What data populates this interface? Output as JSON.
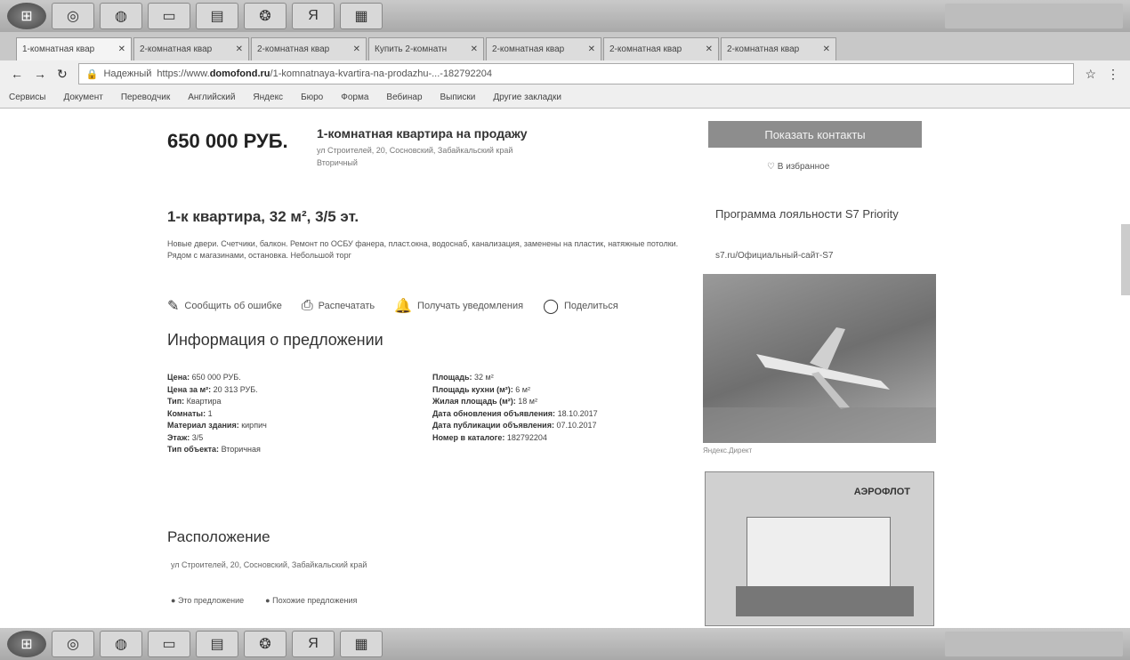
{
  "taskbar": {
    "items": [
      "⊞",
      "◎",
      "◍",
      "▭",
      "▤",
      "❂",
      "Я",
      "▦"
    ]
  },
  "tabs": [
    {
      "label": "1-комнатная квар",
      "active": true
    },
    {
      "label": "2-комнатная квар",
      "active": false
    },
    {
      "label": "2-комнатная квар",
      "active": false
    },
    {
      "label": "Купить 2-комнатн",
      "active": false
    },
    {
      "label": "2-комнатная квар",
      "active": false
    },
    {
      "label": "2-комнатная квар",
      "active": false
    },
    {
      "label": "2-комнатная квар",
      "active": false
    }
  ],
  "browser": {
    "profile": "",
    "secure_label": "Надежный",
    "url_prefix": "https://www.",
    "url_domain": "domofond.ru",
    "url_rest": "/1-komnatnaya-kvartira-na-prodazhu-...-182792204"
  },
  "bookmarks": [
    "Сервисы",
    "Документ",
    "Переводчик",
    "Английский",
    "Яндекс",
    "Бюро",
    "Форма",
    "Вебинар",
    "Выписки",
    "Другие закладки"
  ],
  "listing": {
    "price": "650 000 РУБ.",
    "title": "1-комнатная квартира на продажу",
    "address": "ул Строителей, 20, Сосновский, Забайкальский край",
    "type_label": "Вторичный",
    "heading": "1-к квартира, 32 м², 3/5 эт.",
    "description": "Новые двери. Счетчики, балкон. Ремонт по ОСБУ фанера, пласт.окна, водоснаб, канализация, заменены на пластик, натяжные потолки. Рядом с магазинами, остановка. Небольшой торг",
    "actions": {
      "report": "Сообщить об ошибке",
      "print": "Распечатать",
      "notify": "Получать уведомления",
      "share": "Поделиться"
    }
  },
  "info": {
    "heading": "Информация о предложении",
    "left": [
      {
        "label": "Цена:",
        "value": "650 000 РУБ."
      },
      {
        "label": "Цена за м²:",
        "value": "20 313 РУБ."
      },
      {
        "label": "Тип:",
        "value": "Квартира"
      },
      {
        "label": "Комнаты:",
        "value": "1"
      },
      {
        "label": "Материал здания:",
        "value": "кирпич"
      },
      {
        "label": "Этаж:",
        "value": "3/5"
      },
      {
        "label": "Тип объекта:",
        "value": "Вторичная"
      }
    ],
    "right": [
      {
        "label": "Площадь:",
        "value": "32 м²"
      },
      {
        "label": "Площадь кухни (м²):",
        "value": "6 м²"
      },
      {
        "label": "Жилая площадь (м²):",
        "value": "18 м²"
      },
      {
        "label": "Дата обновления объявления:",
        "value": "18.10.2017"
      },
      {
        "label": "Дата публикации объявления:",
        "value": "07.10.2017"
      },
      {
        "label": "Номер в каталоге:",
        "value": "182792204"
      }
    ]
  },
  "location": {
    "heading": "Расположение",
    "address": "ул Строителей, 20, Сосновский, Забайкальский край",
    "link1": "Это предложение",
    "link2": "Похожие предложения"
  },
  "sidebar": {
    "contact_button": "Показать контакты",
    "favorite": "В избранное",
    "promo_title": "Программа лояльности S7 Priority",
    "promo_link": "s7.ru/Официальный-сайт-S7",
    "ad_caption": "Яндекс.Директ",
    "ad2_logo": "АЭРОФЛОТ"
  }
}
